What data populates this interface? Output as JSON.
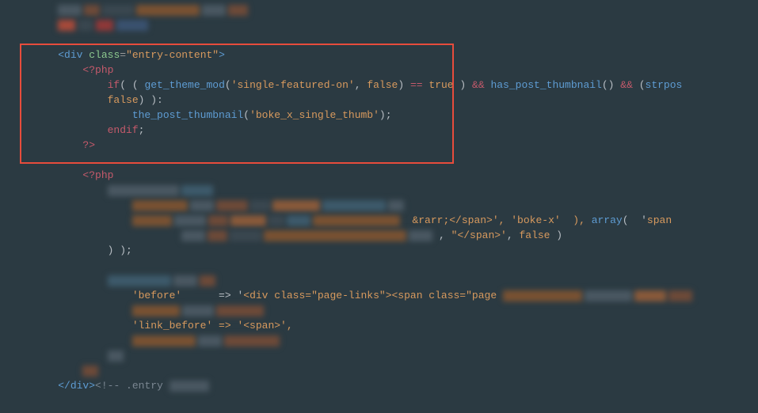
{
  "code": {
    "l1": {
      "ind": "        ",
      "closep": "</",
      "div": "div",
      "closeb": ">",
      "comment": "<!-- .single-excerpt -->"
    },
    "l3": {
      "ind": "    ",
      "open": "<",
      "div": "div",
      "sp": " ",
      "attr": "class",
      "eq": "=",
      "val": "\"entry-content\"",
      "close": ">"
    },
    "l4": {
      "ind": "        ",
      "php": "<?php"
    },
    "l5": {
      "ind": "            ",
      "if": "if",
      "open": "( ( ",
      "fn1": "get_theme_mod",
      "args1a": "(",
      "str1": "'single-featured-on'",
      "comma1": ", ",
      "false1": "false",
      "args1b": ")",
      "sp1": " ",
      "eqeq": "==",
      "sp2": " ",
      "true1": "true",
      "sp3": " ) ",
      "amp1": "&&",
      "sp4": " ",
      "fn2": "has_post_thumbnail",
      "args2": "()",
      "sp5": " ",
      "amp2": "&&",
      "sp6": " (",
      "fn3": "strpos"
    },
    "l6": {
      "ind": "            ",
      "false2": "false",
      "tail": ") ):"
    },
    "l7": {
      "ind": "                ",
      "fn": "the_post_thumbnail",
      "open": "(",
      "str": "'boke_x_single_thumb'",
      "close": ");"
    },
    "l8": {
      "ind": "            ",
      "endif": "endif",
      "semi": ";"
    },
    "l9": {
      "ind": "        ",
      "close": "?>"
    },
    "l11": {
      "ind": "        ",
      "php": "<?php"
    },
    "p1": {
      "ind": "                                                                        ",
      "txt1": "&rarr;</span>', 'boke-x'  ), ",
      "fn": "array",
      "txt2": "(  '",
      "tag": "span"
    },
    "p2": {
      "ind": "                                                                        , '",
      "close": "\"</span>'",
      "comma": ", ",
      "false": "false",
      "tail": " )"
    },
    "l14": {
      "ind": "            ",
      "txt": ") );"
    },
    "p3": {
      "ind": "                ",
      "key": "'before'",
      "arrow": "      => '",
      "tag1": "<div class=\"page-links\"><span class=\"page"
    },
    "p4": {
      "ind": "                ",
      "key": "'link_before' => '<span>',"
    },
    "l18": {
      "ind": "            ",
      "semi": ","
    },
    "l20": {
      "ind": "    ",
      "closep": "</",
      "div": "div",
      "closeb": ">",
      "comment": "<!-- .entry"
    }
  }
}
